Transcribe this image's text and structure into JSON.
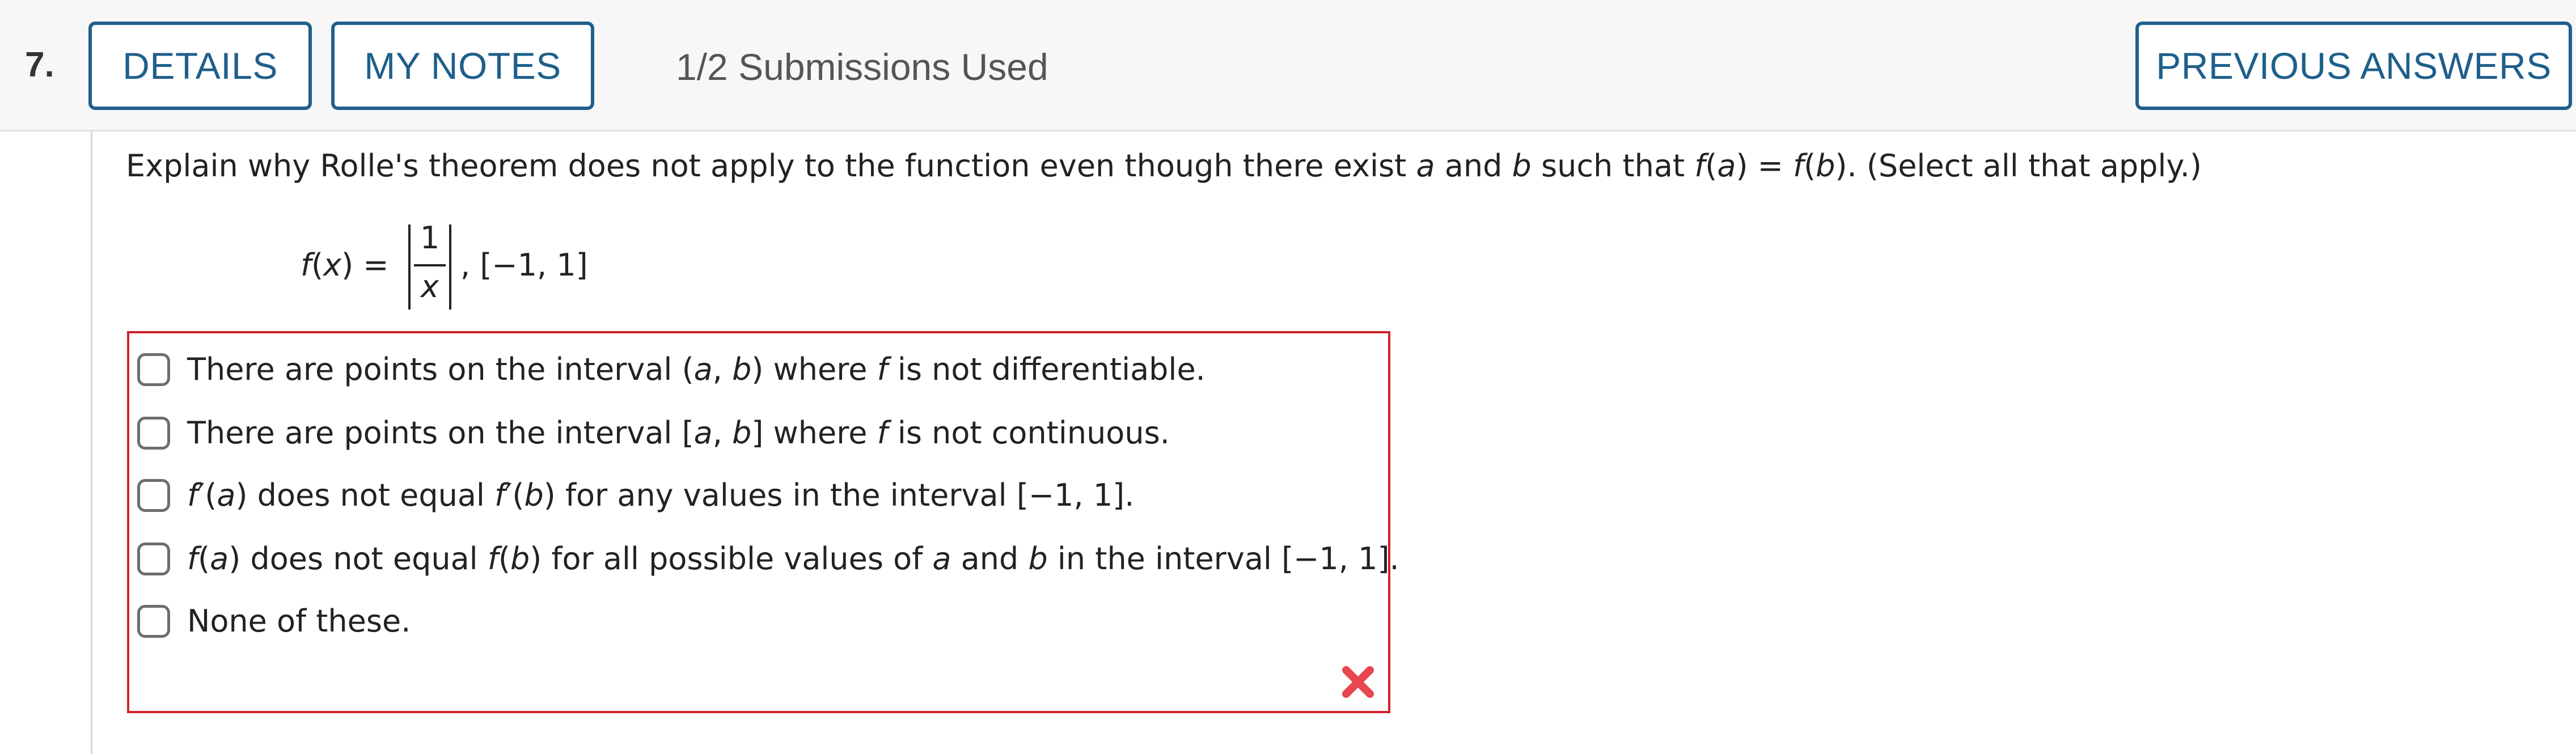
{
  "question": {
    "number": "7.",
    "details_label": "DETAILS",
    "notes_label": "MY NOTES",
    "submissions": "1/2 Submissions Used",
    "previous_label": "PREVIOUS ANSWERS"
  },
  "prompt": {
    "p1": "Explain why Rolle's theorem does not apply to the function even though there exist ",
    "a": "a",
    "p2": " and ",
    "b": "b",
    "p3": " such that ",
    "fa_f": "f",
    "fa_open": "(",
    "fa_a": "a",
    "fa_close": ") = ",
    "fb_f": "f",
    "fb_open": "(",
    "fb_b": "b",
    "fb_close": "). (Select all that apply.)"
  },
  "formula": {
    "f": "f",
    "paren_open": "(",
    "x": "x",
    "paren_close_eq": ") =",
    "numerator": "1",
    "denominator": "x",
    "rest": ",   [−1, 1]"
  },
  "options": [
    {
      "t1": "There are points on the interval (",
      "v1": "a",
      "t2": ", ",
      "v2": "b",
      "t3": ") where ",
      "v3": "f",
      "t4": " is not differentiable."
    },
    {
      "t1": "There are points on the interval [",
      "v1": "a",
      "t2": ", ",
      "v2": "b",
      "t3": "] where ",
      "v3": "f",
      "t4": " is not continuous."
    },
    {
      "v1": "f",
      "t1": "′(",
      "v2": "a",
      "t2": ") does not equal ",
      "v3": "f",
      "t3": "′(",
      "v4": "b",
      "t4": ") for any values in the interval [−1, 1]."
    },
    {
      "v1": "f",
      "t1": "(",
      "v2": "a",
      "t2": ") does not equal ",
      "v3": "f",
      "t3": "(",
      "v4": "b",
      "t4": ") for all possible values of ",
      "v5": "a",
      "t5": " and ",
      "v6": "b",
      "t6": " in the interval [−1, 1]."
    },
    {
      "t1": "None of these."
    }
  ],
  "status": {
    "icon": "incorrect-x-icon",
    "color": "#e8474f",
    "border_color": "#d0232a"
  },
  "theme": {
    "accent": "#1f5f8b"
  }
}
